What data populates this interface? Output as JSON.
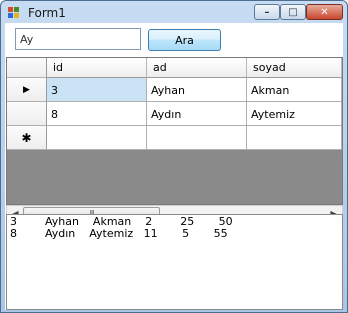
{
  "window": {
    "title": "Form1",
    "min_glyph": "–",
    "max_glyph": "□",
    "close_glyph": "✕"
  },
  "search": {
    "value": "Ay",
    "button_label": "Ara"
  },
  "grid": {
    "columns": [
      "id",
      "ad",
      "soyad"
    ],
    "rows": [
      {
        "marker": "▶",
        "id": "3",
        "ad": "Ayhan",
        "soyad": "Akman"
      },
      {
        "marker": "",
        "id": "8",
        "ad": "Aydın",
        "soyad": "Aytemiz"
      }
    ],
    "new_row_marker": "✱"
  },
  "scrollbar": {
    "left_arrow": "◀",
    "right_arrow": "▶",
    "grip": "III"
  },
  "results": [
    "3        Ayhan    Akman    2        25       50",
    "8        Aydın    Aytemiz   11       5       55"
  ],
  "colors": {
    "selected_cell": "#c9e3f5",
    "grid_background": "#8a8a8a",
    "button_border": "#3c7fb1"
  }
}
